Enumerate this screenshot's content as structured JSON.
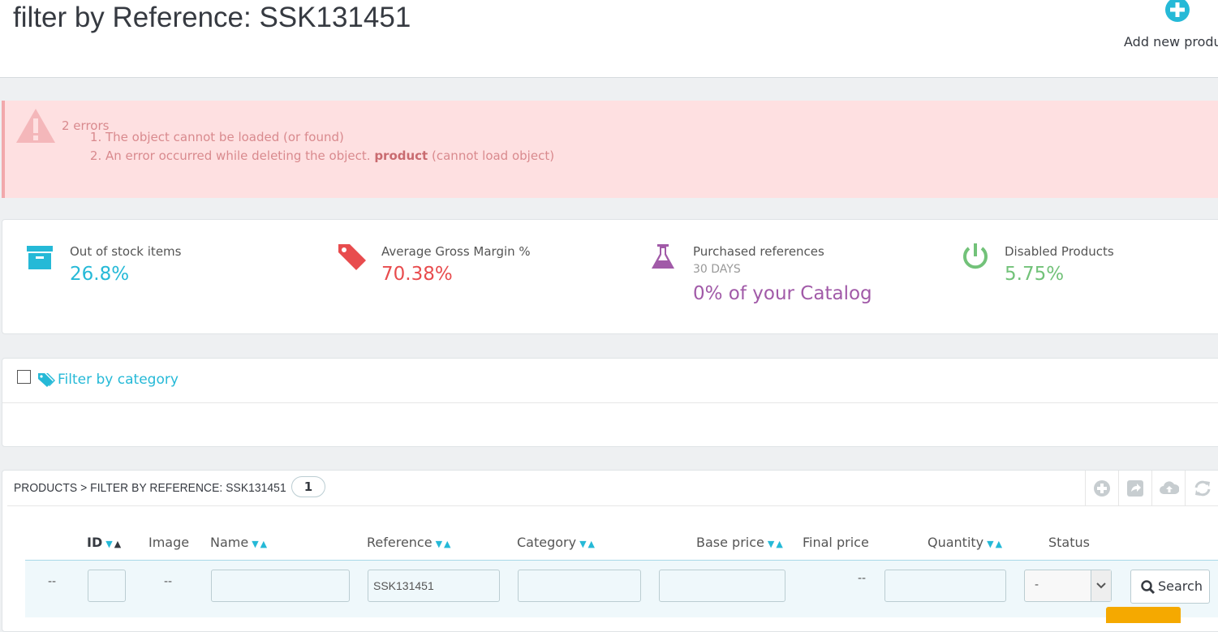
{
  "header": {
    "title": "filter by Reference: SSK131451",
    "add_new_label": "Add new product"
  },
  "alert": {
    "count": "2 errors",
    "errors": [
      "The object cannot be loaded (or found)",
      "An error occurred while deleting the object."
    ],
    "error2_bold": "product",
    "error2_suffix": "(cannot load object)"
  },
  "kpis": [
    {
      "title": "Out of stock items",
      "value": "26.8%",
      "color": "#25b9d7",
      "icon": "archive-box-icon"
    },
    {
      "title": "Average Gross Margin %",
      "value": "70.38%",
      "color": "#e84c4e",
      "icon": "tags-icon"
    },
    {
      "title": "Purchased references",
      "subtitle": "30 DAYS",
      "value": "0% of your Catalog",
      "color": "#a15aa8",
      "icon": "flask-icon"
    },
    {
      "title": "Disabled Products",
      "value": "5.75%",
      "color": "#72c279",
      "icon": "power-icon"
    }
  ],
  "category_filter": {
    "label": "Filter by category"
  },
  "products": {
    "title": "PRODUCTS > FILTER BY REFERENCE: SSK131451",
    "count": "1",
    "columns": [
      "ID",
      "Image",
      "Name",
      "Reference",
      "Category",
      "Base price",
      "Final price",
      "Quantity",
      "Status"
    ],
    "filters": {
      "id_placeholder_dash": "--",
      "image_dash": "--",
      "final_price_dash": "--",
      "reference_value": "SSK131451",
      "status_value": "-",
      "search_label": "Search"
    }
  },
  "colors": {
    "accent": "#25b9d7",
    "error_bg": "#fee0e1",
    "error_text": "#d98a8e"
  }
}
